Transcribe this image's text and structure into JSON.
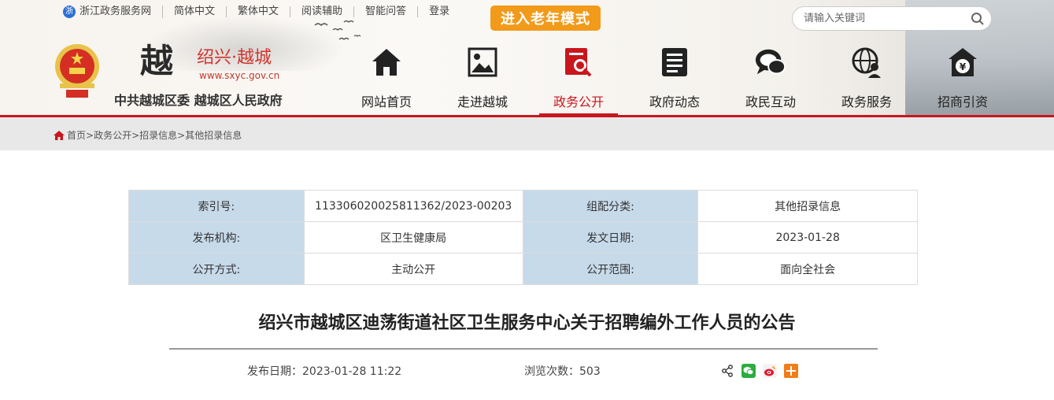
{
  "topbar": {
    "portal": "浙江政务服务网",
    "simplified": "简体中文",
    "traditional": "繁体中文",
    "reading": "阅读辅助",
    "qa": "智能问答",
    "login": "登录",
    "elder_mode": "进入老年模式"
  },
  "search": {
    "placeholder": "请输入关键词"
  },
  "brand": {
    "char": "越",
    "name": "绍兴·越城",
    "url": "www.sxyc.gov.cn",
    "gov": "中共越城区委 越城区人民政府"
  },
  "nav": [
    {
      "label": "网站首页",
      "icon": "home-icon"
    },
    {
      "label": "走进越城",
      "icon": "picture-icon"
    },
    {
      "label": "政务公开",
      "icon": "document-search-icon",
      "active": true
    },
    {
      "label": "政府动态",
      "icon": "news-icon"
    },
    {
      "label": "政民互动",
      "icon": "chat-icon"
    },
    {
      "label": "政务服务",
      "icon": "globe-user-icon"
    },
    {
      "label": "招商引资",
      "icon": "money-house-icon"
    }
  ],
  "breadcrumb": {
    "home": "首页",
    "l1": "政务公开",
    "l2": "招录信息",
    "l3": "其他招录信息",
    "sep": ">"
  },
  "meta": {
    "index_label": "索引号:",
    "index_value": "11330602002581136​2/2023-00203",
    "category_label": "组配分类:",
    "category_value": "其他招录信息",
    "org_label": "发布机构:",
    "org_value": "区卫生健康局",
    "date_label": "发文日期:",
    "date_value": "2023-01-28",
    "mode_label": "公开方式:",
    "mode_value": "主动公开",
    "scope_label": "公开范围:",
    "scope_value": "面向全社会"
  },
  "article": {
    "title": "绍兴市越城区迪荡街道社区卫生服务中心关于招聘编外工作人员的公告",
    "publish_date": "发布日期：2023-01-28 11:22",
    "views": "浏览次数：503"
  },
  "colors": {
    "accent": "#c9161d",
    "elder": "#f29a1a",
    "meta_key_bg": "#c7daea"
  }
}
